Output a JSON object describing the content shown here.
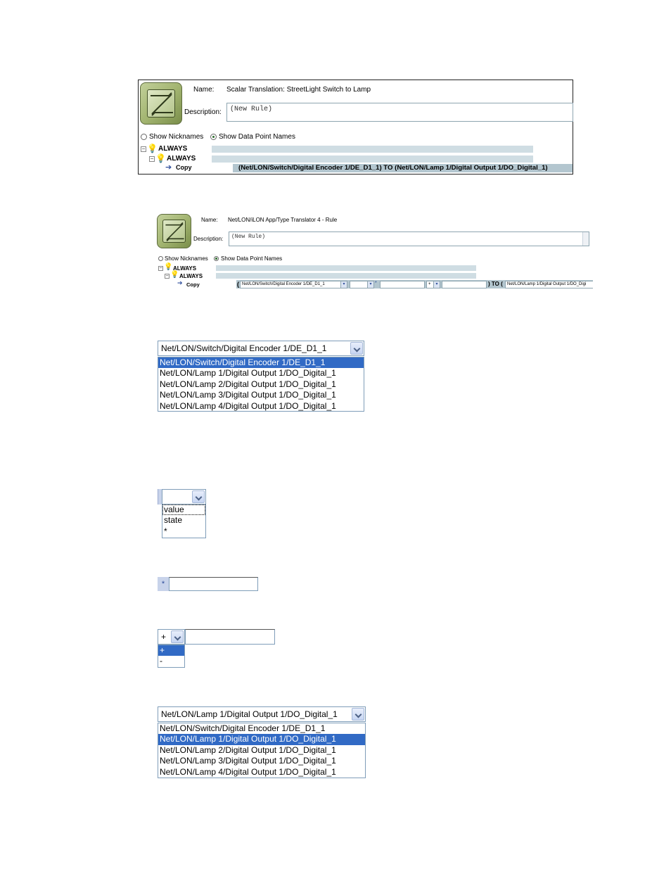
{
  "panel1": {
    "name_label": "Name:",
    "name_value": "Scalar Translation: StreetLight Switch to Lamp",
    "description_label": "Description:",
    "description_value": "(New Rule)",
    "show_nicknames": "Show Nicknames",
    "show_dp_names": "Show Data Point Names",
    "tree": {
      "always1": "ALWAYS",
      "always2": "ALWAYS",
      "copy": "Copy",
      "copy_expr": "(Net/LON/Switch/Digital Encoder 1/DE_D1_1) TO (Net/LON/Lamp 1/Digital Output 1/DO_Digital_1)"
    }
  },
  "panel2": {
    "name_label": "Name:",
    "name_value": "Net/LON/iLON App/Type Translator 4 - Rule",
    "description_label": "Description:",
    "description_value": "(New Rule)",
    "show_nicknames": "Show Nicknames",
    "show_dp_names": "Show Data Point Names",
    "tree": {
      "always1": "ALWAYS",
      "always2": "ALWAYS",
      "copy": "Copy",
      "open_paren": "(",
      "source_select": "Net/LON/Switch/Digital Encoder 1/DE_D1_1",
      "field_select": "",
      "op_select": "*",
      "sign_select": "+",
      "to_text": ") TO (",
      "target_select": "Net/LON/Lamp 1/Digital Output 1/DO_Digi"
    }
  },
  "dropdown_source": {
    "selected": "Net/LON/Switch/Digital Encoder 1/DE_D1_1",
    "options": [
      "Net/LON/Switch/Digital Encoder 1/DE_D1_1",
      "Net/LON/Lamp 1/Digital Output 1/DO_Digital_1",
      "Net/LON/Lamp 2/Digital Output 1/DO_Digital_1",
      "Net/LON/Lamp 3/Digital Output 1/DO_Digital_1",
      "Net/LON/Lamp 4/Digital Output 1/DO_Digital_1"
    ]
  },
  "dropdown_field": {
    "selected": "",
    "options": [
      "value",
      "state",
      "*"
    ]
  },
  "multiplier": {
    "symbol": "*"
  },
  "dropdown_sign": {
    "selected": "+",
    "options": [
      "+",
      "-"
    ]
  },
  "dropdown_target": {
    "selected": "Net/LON/Lamp 1/Digital Output 1/DO_Digital_1",
    "options": [
      "Net/LON/Switch/Digital Encoder 1/DE_D1_1",
      "Net/LON/Lamp 1/Digital Output 1/DO_Digital_1",
      "Net/LON/Lamp 2/Digital Output 1/DO_Digital_1",
      "Net/LON/Lamp 3/Digital Output 1/DO_Digital_1",
      "Net/LON/Lamp 4/Digital Output 1/DO_Digital_1"
    ]
  }
}
